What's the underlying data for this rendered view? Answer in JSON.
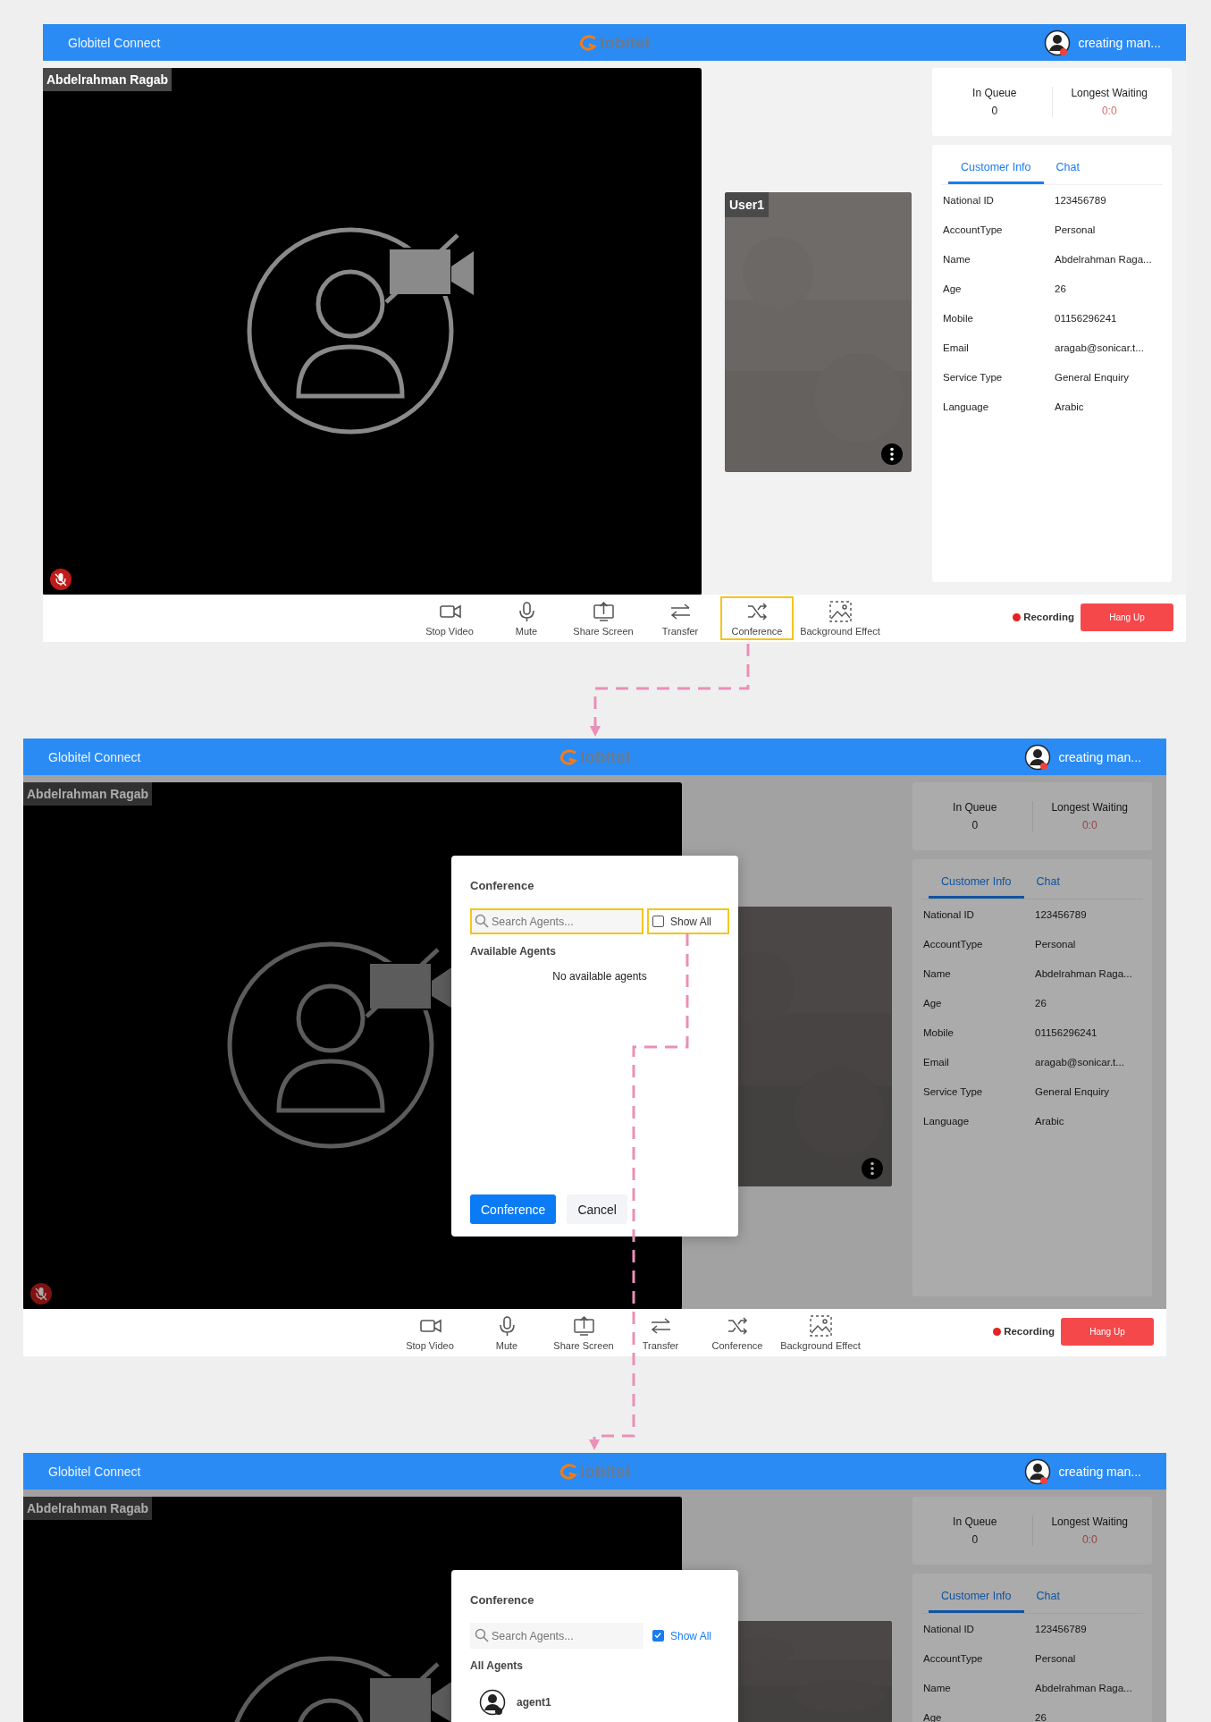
{
  "screens": [
    {
      "dimmed": false,
      "header": {
        "title": "Globitel Connect",
        "logo": "lobitel",
        "user": "creating man..."
      },
      "video": {
        "name": "Abdelrahman Ragab",
        "muted": true
      },
      "tile": {
        "kind": "picture",
        "label": "User1"
      },
      "stats": [
        {
          "label": "In Queue",
          "value": "0",
          "kind": "count"
        },
        {
          "label": "Longest Waiting",
          "value": "0:0",
          "kind": "time"
        }
      ],
      "tabs": [
        {
          "label": "Customer Info",
          "selected": true
        },
        {
          "label": "Chat",
          "selected": false
        }
      ],
      "info": [
        {
          "label": "National ID",
          "value": "123456789"
        },
        {
          "label": "AccountType",
          "value": "Personal"
        },
        {
          "label": "Name",
          "value": "Abdelrahman Raga..."
        },
        {
          "label": "Age",
          "value": "26"
        },
        {
          "label": "Mobile",
          "value": "01156296241"
        },
        {
          "label": "Email",
          "value": "aragab@sonicar.t..."
        },
        {
          "label": "Service Type",
          "value": "General Enquiry"
        },
        {
          "label": "Language",
          "value": "Arabic"
        }
      ],
      "toolbar": {
        "items": [
          {
            "label": "Stop Video",
            "kind": "video",
            "highlighted": false
          },
          {
            "label": "Mute",
            "kind": "mic",
            "highlighted": false
          },
          {
            "label": "Share Screen",
            "kind": "share",
            "highlighted": false
          },
          {
            "label": "Transfer",
            "kind": "transfer",
            "highlighted": false
          },
          {
            "label": "Conference",
            "kind": "conference",
            "highlighted": true
          },
          {
            "label": "Background Effect",
            "kind": "background",
            "highlighted": false
          }
        ],
        "recording": "Recording",
        "hangup": "Hang Up"
      }
    },
    {
      "dimmed": true,
      "header": {
        "title": "Globitel Connect",
        "logo": "lobitel",
        "user": "creating man..."
      },
      "video": {
        "name": "Abdelrahman Ragab",
        "muted": true
      },
      "tile": {
        "kind": "picture"
      },
      "stats": [
        {
          "label": "In Queue",
          "value": "0",
          "kind": "count"
        },
        {
          "label": "Longest Waiting",
          "value": "0:0",
          "kind": "time"
        }
      ],
      "tabs": [
        {
          "label": "Customer Info",
          "selected": true
        },
        {
          "label": "Chat",
          "selected": false
        }
      ],
      "info": [
        {
          "label": "National ID",
          "value": "123456789"
        },
        {
          "label": "AccountType",
          "value": "Personal"
        },
        {
          "label": "Name",
          "value": "Abdelrahman Raga..."
        },
        {
          "label": "Age",
          "value": "26"
        },
        {
          "label": "Mobile",
          "value": "01156296241"
        },
        {
          "label": "Email",
          "value": "aragab@sonicar.t..."
        },
        {
          "label": "Service Type",
          "value": "General Enquiry"
        },
        {
          "label": "Language",
          "value": "Arabic"
        }
      ],
      "dialog": {
        "title": "Conference",
        "search": {
          "placeholder": "Search Agents...",
          "highlighted": true
        },
        "show_all": {
          "label": "Show All",
          "checked": false,
          "highlighted": true
        },
        "section": "Available Agents",
        "empty": "No available agents",
        "buttons": [
          {
            "label": "Conference",
            "kind": "primary"
          },
          {
            "label": "Cancel",
            "kind": "secondary"
          }
        ]
      },
      "toolbar": {
        "items": [
          {
            "label": "Stop Video",
            "kind": "video",
            "highlighted": false
          },
          {
            "label": "Mute",
            "kind": "mic",
            "highlighted": false
          },
          {
            "label": "Share Screen",
            "kind": "share",
            "highlighted": false
          },
          {
            "label": "Transfer",
            "kind": "transfer",
            "highlighted": false
          },
          {
            "label": "Conference",
            "kind": "conference",
            "highlighted": false
          },
          {
            "label": "Background Effect",
            "kind": "background",
            "highlighted": false
          }
        ],
        "recording": "Recording",
        "hangup": "Hang Up"
      }
    },
    {
      "dimmed": true,
      "header": {
        "title": "Globitel Connect",
        "logo": "lobitel",
        "user": "creating man..."
      },
      "video": {
        "name": "Abdelrahman Ragab"
      },
      "tile": {
        "kind": "picture"
      },
      "stats": [
        {
          "label": "In Queue",
          "value": "0",
          "kind": "count"
        },
        {
          "label": "Longest Waiting",
          "value": "0:0",
          "kind": "time"
        }
      ],
      "tabs": [
        {
          "label": "Customer Info",
          "selected": true
        },
        {
          "label": "Chat",
          "selected": false
        }
      ],
      "info": [
        {
          "label": "National ID",
          "value": "123456789"
        },
        {
          "label": "AccountType",
          "value": "Personal"
        },
        {
          "label": "Name",
          "value": "Abdelrahman Raga..."
        },
        {
          "label": "Age",
          "value": "26"
        }
      ],
      "dialog": {
        "title": "Conference",
        "search": {
          "placeholder": "Search Agents...",
          "highlighted": false
        },
        "show_all": {
          "label": "Show All",
          "checked": true,
          "highlighted": false
        },
        "section": "All Agents",
        "agents": [
          {
            "name": "agent1"
          }
        ]
      }
    }
  ]
}
